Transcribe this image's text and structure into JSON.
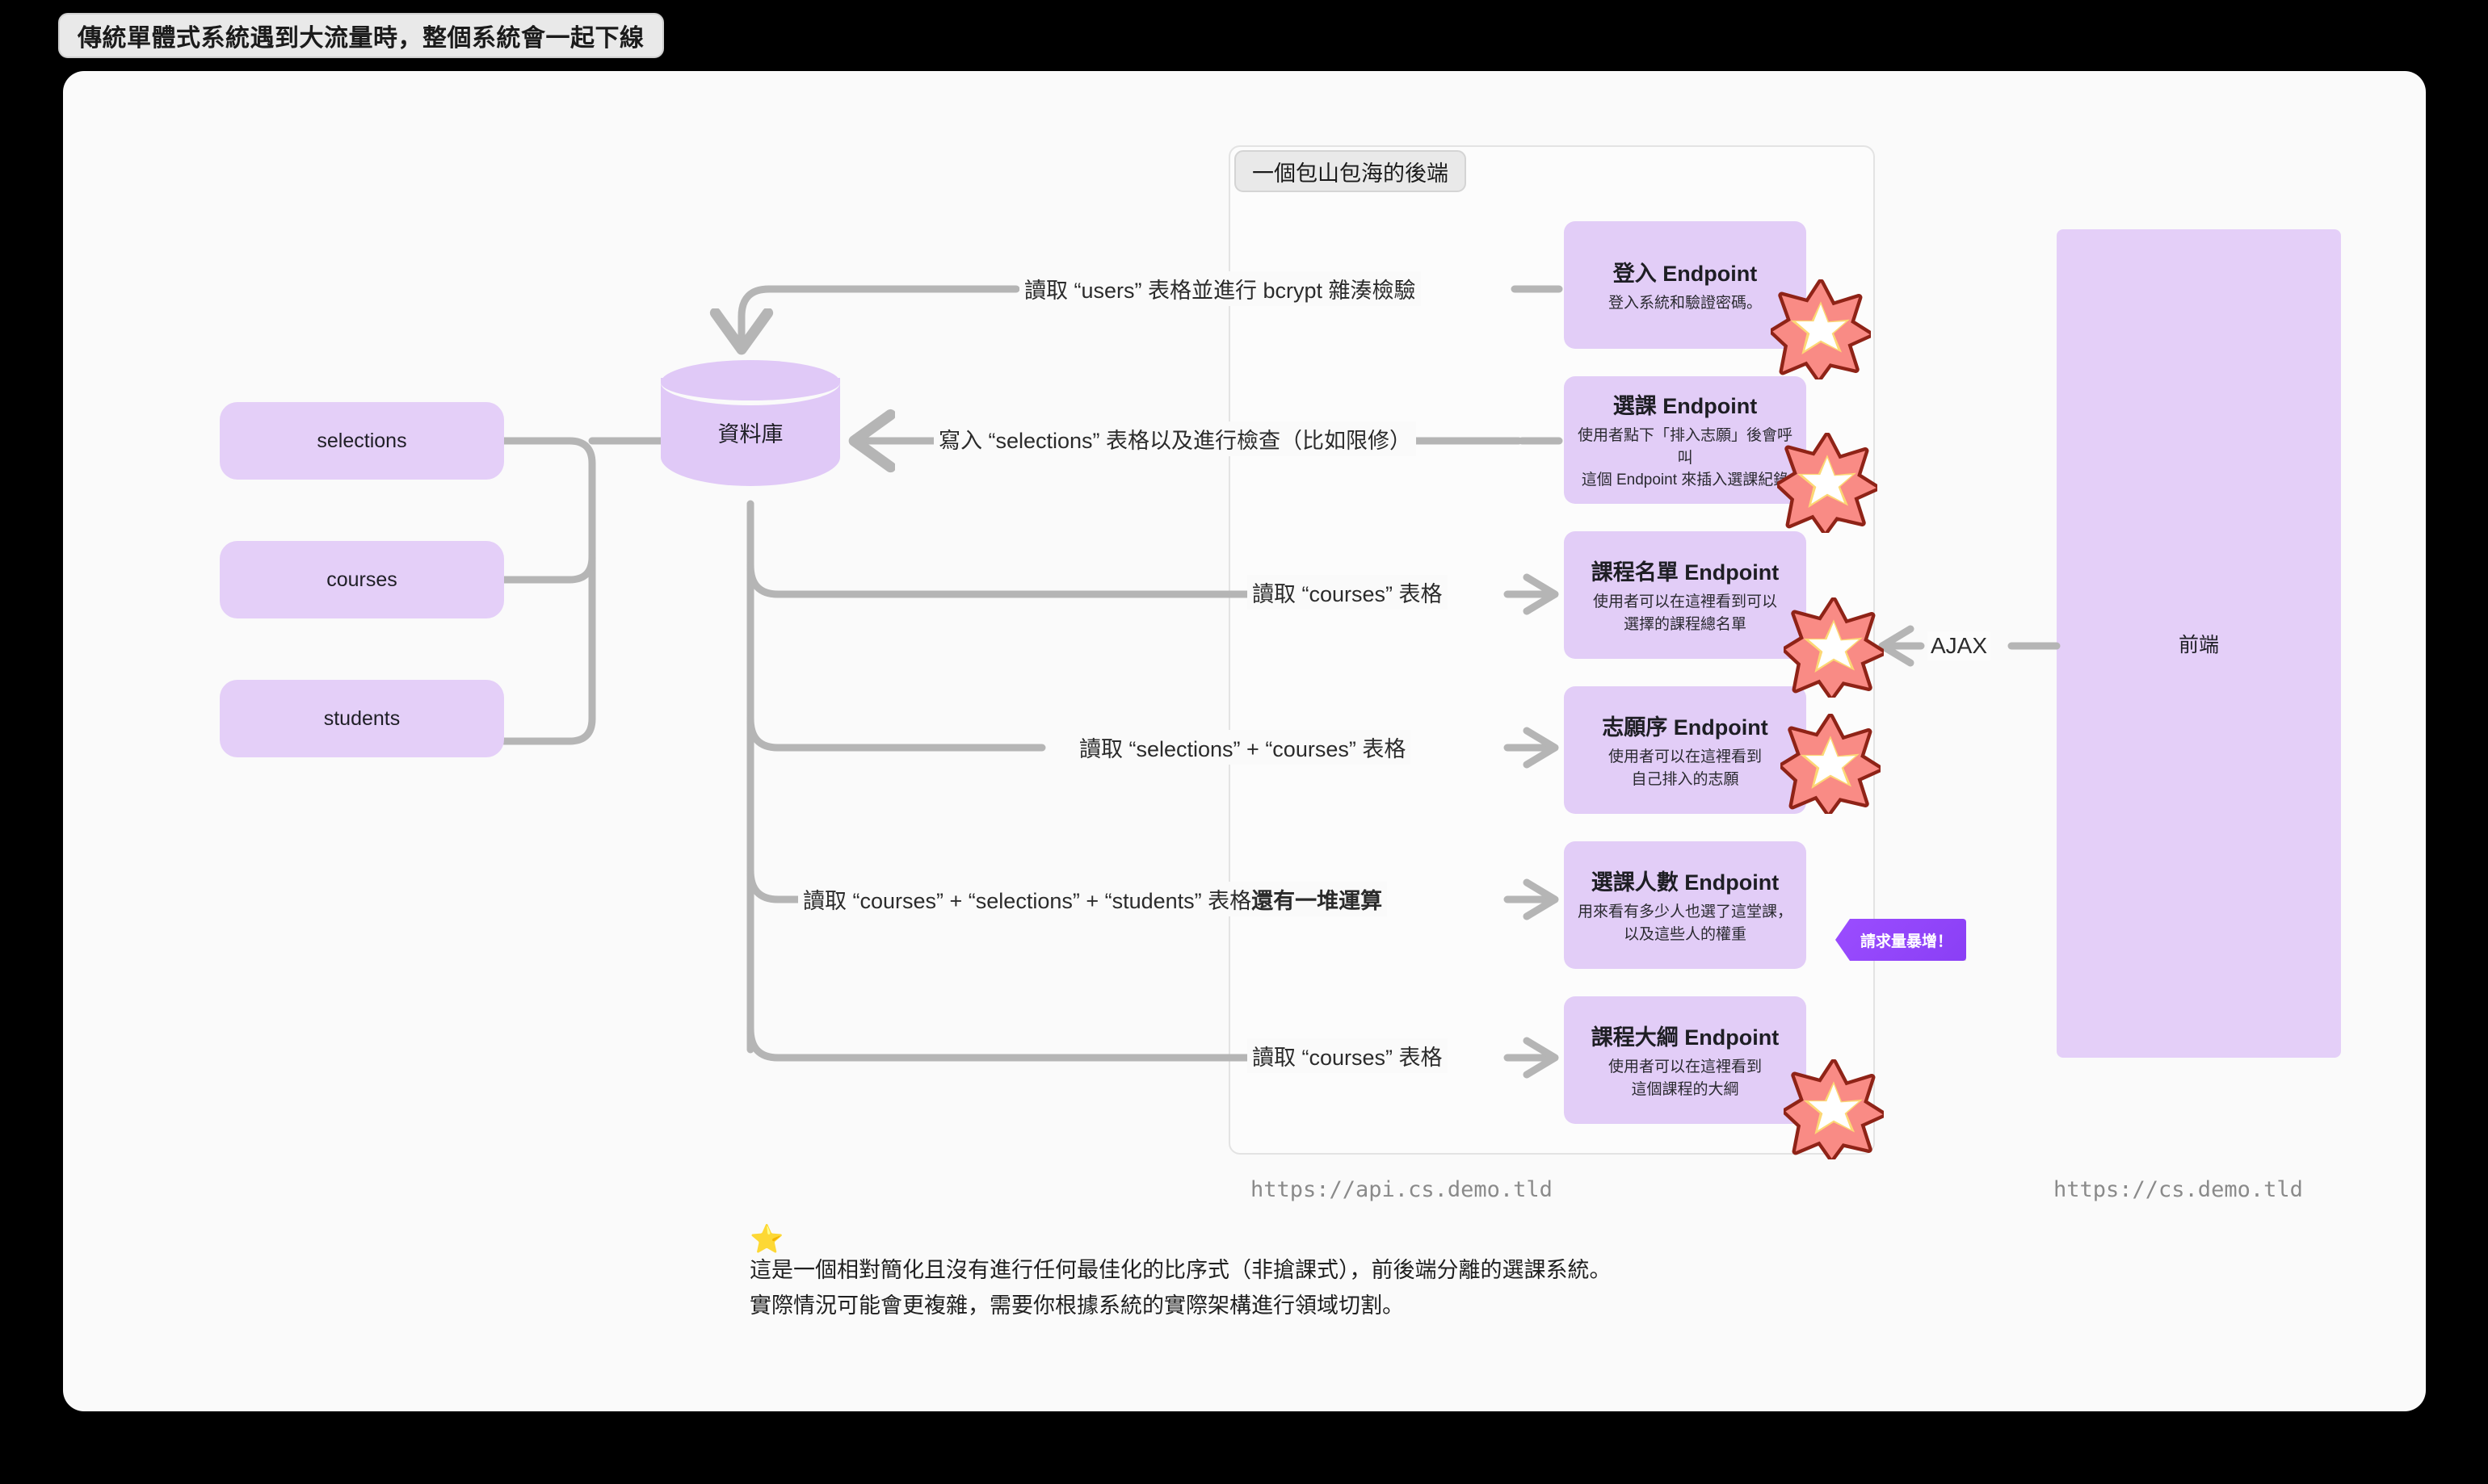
{
  "title": "傳統單體式系統遇到大流量時，整個系統會一起下線",
  "backend": {
    "label": "一個包山包海的後端",
    "url": "https://api.cs.demo.tld"
  },
  "frontend": {
    "label": "前端",
    "url": "https://cs.demo.tld"
  },
  "database": {
    "label": "資料庫",
    "tables": [
      {
        "name": "selections"
      },
      {
        "name": "courses"
      },
      {
        "name": "students"
      }
    ]
  },
  "endpoints": [
    {
      "title": "登入 Endpoint",
      "desc": "登入系統和驗證密碼。",
      "edge_label": "讀取 “users” 表格並進行 bcrypt 雜湊檢驗"
    },
    {
      "title": "選課 Endpoint",
      "desc_line1": "使用者點下「排入志願」後會呼叫",
      "desc_line2": "這個 Endpoint 來插入選課紀錄",
      "edge_label": "寫入 “selections” 表格以及進行檢查（比如限修）"
    },
    {
      "title": "課程名單 Endpoint",
      "desc_line1": "使用者可以在這裡看到可以",
      "desc_line2": "選擇的課程總名單",
      "edge_label": "讀取 “courses” 表格"
    },
    {
      "title": "志願序 Endpoint",
      "desc_line1": "使用者可以在這裡看到",
      "desc_line2": "自己排入的志願",
      "edge_label": "讀取 “selections” + “courses” 表格"
    },
    {
      "title": "選課人數 Endpoint",
      "desc_line1": "用來看有多少人也選了這堂課，",
      "desc_line2": "以及這些人的權重",
      "edge_label_normal": "讀取 “courses” + “selections” + “students” 表格",
      "edge_label_bold": "還有一堆運算"
    },
    {
      "title": "課程大綱 Endpoint",
      "desc_line1": "使用者可以在這裡看到",
      "desc_line2": "這個課程的大綱",
      "edge_label": "讀取 “courses” 表格"
    }
  ],
  "ajax_label": "AJAX",
  "surge_badge": "請求量暴增！",
  "footnote": {
    "star": "⭐",
    "line1": "這是一個相對簡化且沒有進行任何最佳化的比序式（非搶課式），前後端分離的選課系統。",
    "line2": "實際情況可能會更複雜，需要你根據系統的實際架構進行領域切割。"
  },
  "colors": {
    "purple_fill": "#e2cdf7",
    "accent_purple": "#9b4dff",
    "edge_gray": "#b5b5b5",
    "canvas": "#fafafa",
    "page": "#000000"
  }
}
